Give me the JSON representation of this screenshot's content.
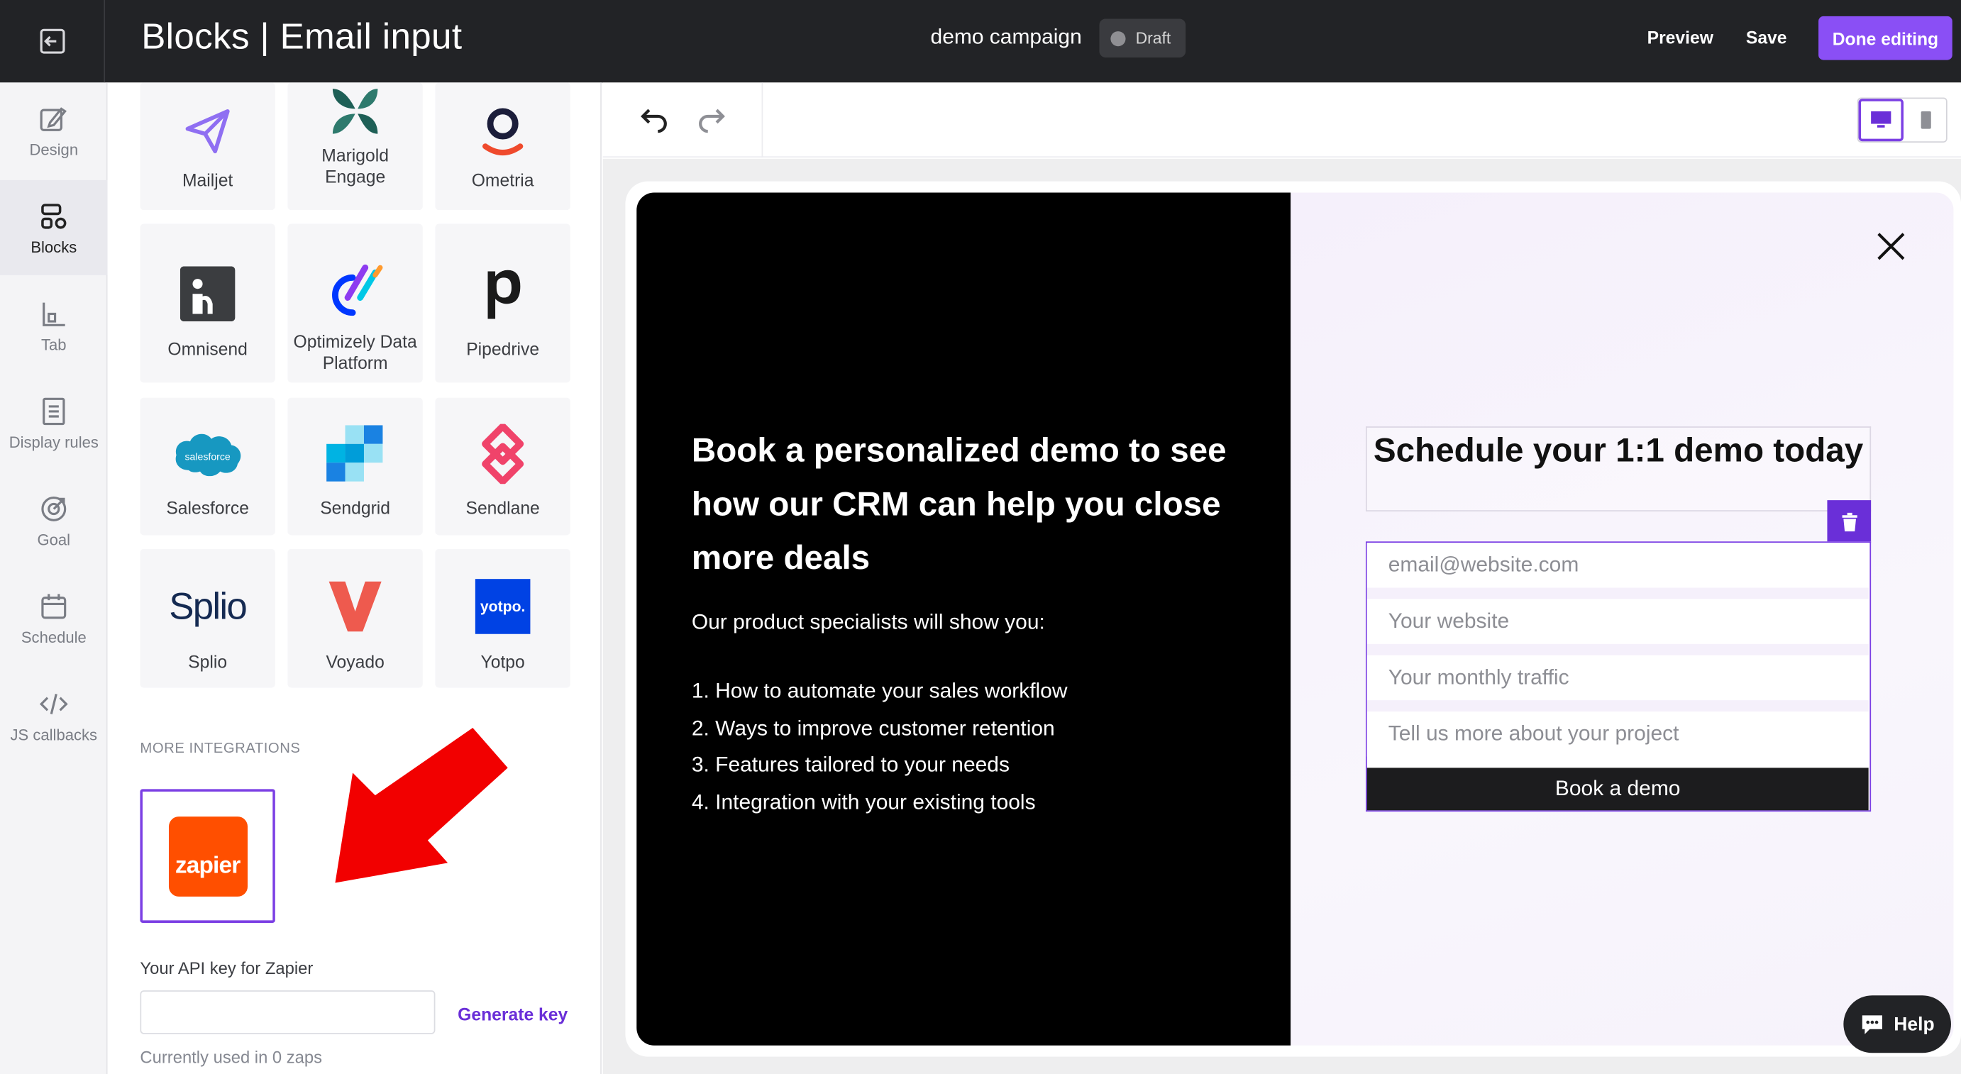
{
  "topbar": {
    "title": "Blocks | Email input",
    "campaign": "demo campaign",
    "status": "Draft",
    "preview": "Preview",
    "save": "Save",
    "done": "Done editing"
  },
  "nav": {
    "design": "Design",
    "blocks": "Blocks",
    "tab": "Tab",
    "display_rules": "Display rules",
    "goal": "Goal",
    "schedule": "Schedule",
    "js_callbacks": "JS callbacks"
  },
  "integrations": [
    {
      "name": "Mailjet",
      "icon": "mailjet-icon"
    },
    {
      "name": "Marigold Engage",
      "icon": "marigold-icon"
    },
    {
      "name": "Ometria",
      "icon": "ometria-icon"
    },
    {
      "name": "Omnisend",
      "icon": "omnisend-icon"
    },
    {
      "name": "Optimizely Data Platform",
      "icon": "optimizely-icon"
    },
    {
      "name": "Pipedrive",
      "icon": "pipedrive-icon"
    },
    {
      "name": "Salesforce",
      "icon": "salesforce-icon"
    },
    {
      "name": "Sendgrid",
      "icon": "sendgrid-icon"
    },
    {
      "name": "Sendlane",
      "icon": "sendlane-icon"
    },
    {
      "name": "Splio",
      "icon": "splio-icon"
    },
    {
      "name": "Voyado",
      "icon": "voyado-icon"
    },
    {
      "name": "Yotpo",
      "icon": "yotpo-icon"
    }
  ],
  "logo_text": {
    "salesforce": "salesforce",
    "splio": "Splio",
    "yotpo": "yotpo.",
    "zapier": "zapier"
  },
  "more": {
    "label": "MORE INTEGRATIONS",
    "api_label": "Your API key for Zapier",
    "api_value": "",
    "generate": "Generate key",
    "used": "Currently used in 0 zaps"
  },
  "popup": {
    "headline": "Book a personalized demo to see how our CRM can help you close more deals",
    "subline": "Our product specialists will show you:",
    "bullets": [
      "1. How to automate your sales workflow",
      "2. Ways to improve customer retention",
      "3. Features tailored to your needs",
      "4. Integration with your existing tools"
    ],
    "form_title": "Schedule your 1:1 demo today",
    "fields": [
      "email@website.com",
      "Your website",
      "Your monthly traffic",
      "Tell us more about your project"
    ],
    "button": "Book a demo"
  },
  "help": "Help",
  "colors": {
    "accent": "#8a4ff5",
    "topbar": "#222326",
    "zapier": "#ff4f00",
    "arrow": "#f20000"
  }
}
